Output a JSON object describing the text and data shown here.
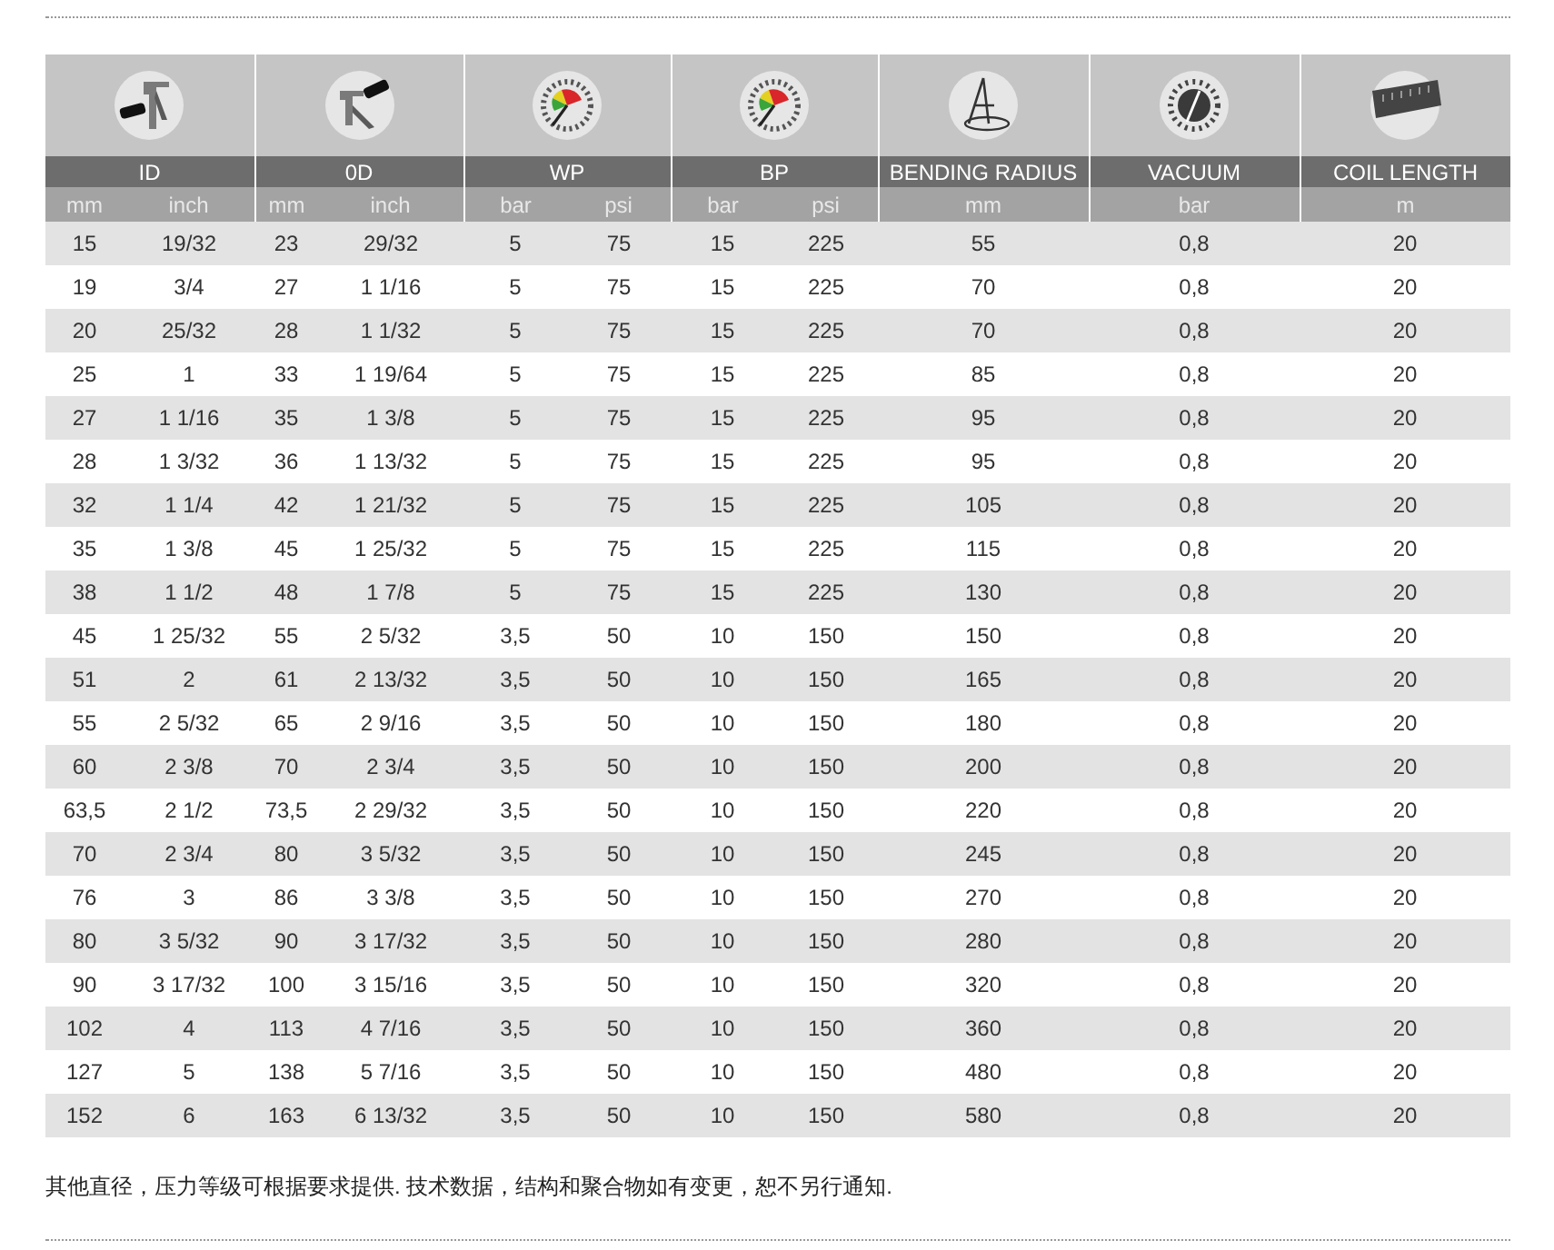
{
  "table": {
    "groups": [
      {
        "kind": "caliper",
        "label": "ID",
        "units": [
          "mm",
          "inch"
        ]
      },
      {
        "kind": "caliper-open",
        "label": "0D",
        "units": [
          "mm",
          "inch"
        ]
      },
      {
        "kind": "gauge",
        "label": "WP",
        "units": [
          "bar",
          "psi"
        ]
      },
      {
        "kind": "gauge",
        "label": "BP",
        "units": [
          "bar",
          "psi"
        ]
      },
      {
        "kind": "compass",
        "label": "BENDING RADIUS",
        "units": [
          "mm"
        ]
      },
      {
        "kind": "dial",
        "label": "VACUUM",
        "units": [
          "bar"
        ]
      },
      {
        "kind": "tape",
        "label": "COIL LENGTH",
        "units": [
          "m"
        ]
      }
    ],
    "rows": [
      [
        "15",
        "19/32",
        "23",
        "29/32",
        "5",
        "75",
        "15",
        "225",
        "55",
        "0,8",
        "20"
      ],
      [
        "19",
        "3/4",
        "27",
        "1 1/16",
        "5",
        "75",
        "15",
        "225",
        "70",
        "0,8",
        "20"
      ],
      [
        "20",
        "25/32",
        "28",
        "1 1/32",
        "5",
        "75",
        "15",
        "225",
        "70",
        "0,8",
        "20"
      ],
      [
        "25",
        "1",
        "33",
        "1 19/64",
        "5",
        "75",
        "15",
        "225",
        "85",
        "0,8",
        "20"
      ],
      [
        "27",
        "1 1/16",
        "35",
        "1 3/8",
        "5",
        "75",
        "15",
        "225",
        "95",
        "0,8",
        "20"
      ],
      [
        "28",
        "1 3/32",
        "36",
        "1 13/32",
        "5",
        "75",
        "15",
        "225",
        "95",
        "0,8",
        "20"
      ],
      [
        "32",
        "1 1/4",
        "42",
        "1 21/32",
        "5",
        "75",
        "15",
        "225",
        "105",
        "0,8",
        "20"
      ],
      [
        "35",
        "1 3/8",
        "45",
        "1 25/32",
        "5",
        "75",
        "15",
        "225",
        "115",
        "0,8",
        "20"
      ],
      [
        "38",
        "1 1/2",
        "48",
        "1 7/8",
        "5",
        "75",
        "15",
        "225",
        "130",
        "0,8",
        "20"
      ],
      [
        "45",
        "1 25/32",
        "55",
        "2 5/32",
        "3,5",
        "50",
        "10",
        "150",
        "150",
        "0,8",
        "20"
      ],
      [
        "51",
        "2",
        "61",
        "2 13/32",
        "3,5",
        "50",
        "10",
        "150",
        "165",
        "0,8",
        "20"
      ],
      [
        "55",
        "2 5/32",
        "65",
        "2 9/16",
        "3,5",
        "50",
        "10",
        "150",
        "180",
        "0,8",
        "20"
      ],
      [
        "60",
        "2 3/8",
        "70",
        "2 3/4",
        "3,5",
        "50",
        "10",
        "150",
        "200",
        "0,8",
        "20"
      ],
      [
        "63,5",
        "2 1/2",
        "73,5",
        "2 29/32",
        "3,5",
        "50",
        "10",
        "150",
        "220",
        "0,8",
        "20"
      ],
      [
        "70",
        "2 3/4",
        "80",
        "3 5/32",
        "3,5",
        "50",
        "10",
        "150",
        "245",
        "0,8",
        "20"
      ],
      [
        "76",
        "3",
        "86",
        "3 3/8",
        "3,5",
        "50",
        "10",
        "150",
        "270",
        "0,8",
        "20"
      ],
      [
        "80",
        "3 5/32",
        "90",
        "3 17/32",
        "3,5",
        "50",
        "10",
        "150",
        "280",
        "0,8",
        "20"
      ],
      [
        "90",
        "3 17/32",
        "100",
        "3 15/16",
        "3,5",
        "50",
        "10",
        "150",
        "320",
        "0,8",
        "20"
      ],
      [
        "102",
        "4",
        "113",
        "4 7/16",
        "3,5",
        "50",
        "10",
        "150",
        "360",
        "0,8",
        "20"
      ],
      [
        "127",
        "5",
        "138",
        "5 7/16",
        "3,5",
        "50",
        "10",
        "150",
        "480",
        "0,8",
        "20"
      ],
      [
        "152",
        "6",
        "163",
        "6 13/32",
        "3,5",
        "50",
        "10",
        "150",
        "580",
        "0,8",
        "20"
      ]
    ]
  },
  "note": "其他直径，压力等级可根据要求提供. 技术数据，结构和聚合物如有变更，恕不另行通知."
}
